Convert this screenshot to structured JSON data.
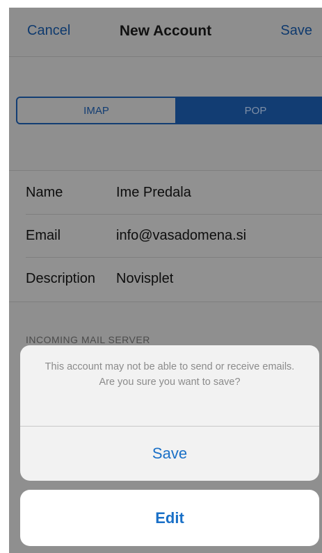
{
  "navbar": {
    "cancel_label": "Cancel",
    "title": "New Account",
    "save_label": "Save"
  },
  "segmented": {
    "options": [
      "IMAP",
      "POP"
    ],
    "selected": "POP"
  },
  "form": {
    "rows": [
      {
        "label": "Name",
        "value": "Ime Predala"
      },
      {
        "label": "Email",
        "value": "info@vasadomena.si"
      },
      {
        "label": "Description",
        "value": "Novisplet"
      }
    ]
  },
  "incoming": {
    "section_header": "INCOMING MAIL SERVER"
  },
  "alert": {
    "message": "This account may not be able to send or receive emails. Are you sure you want to save?",
    "save_label": "Save",
    "edit_label": "Edit"
  },
  "colors": {
    "accent": "#1a70c7",
    "selected_segment": "#123d73",
    "dimmed_background": "#8f8f8f"
  }
}
